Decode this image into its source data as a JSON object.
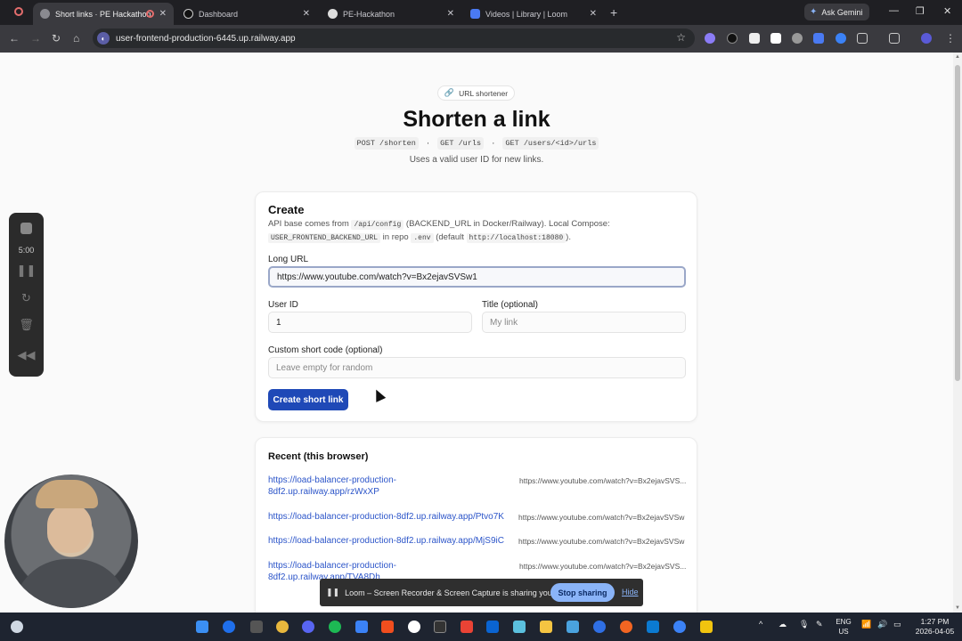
{
  "browser": {
    "tabs": [
      {
        "title": "Short links · PE Hackathon",
        "active": true
      },
      {
        "title": "Dashboard",
        "active": false
      },
      {
        "title": "PE-Hackathon",
        "active": false
      },
      {
        "title": "Videos | Library | Loom",
        "active": false
      }
    ],
    "gemini_label": "Ask Gemini",
    "address": "user-frontend-production-6445.up.railway.app"
  },
  "page": {
    "pill": "URL shortener",
    "title": "Shorten a link",
    "endpoints": [
      "POST /shorten",
      "GET /urls",
      "GET /users/<id>/urls"
    ],
    "endpoint_sep": "·",
    "subtitle": "Uses a valid user ID for new links.",
    "create": {
      "heading": "Create",
      "desc_1": "API base comes from",
      "desc_code_1": "/api/config",
      "desc_2": "(BACKEND_URL in Docker/Railway). Local Compose:",
      "desc_code_2": "USER_FRONTEND_BACKEND_URL",
      "desc_3": "in repo",
      "desc_code_3": ".env",
      "desc_4": "(default",
      "desc_code_4": "http://localhost:18080",
      "desc_5": ").",
      "long_url_label": "Long URL",
      "long_url_value": "https://www.youtube.com/watch?v=Bx2ejavSVSw1",
      "user_id_label": "User ID",
      "user_id_value": "1",
      "title_label": "Title (optional)",
      "title_placeholder": "My link",
      "code_label": "Custom short code (optional)",
      "code_placeholder": "Leave empty for random",
      "submit": "Create short link"
    },
    "recent": {
      "heading": "Recent (this browser)",
      "items": [
        {
          "short": "https://load-balancer-production-8df2.up.railway.app/rzWxXP",
          "original": "https://www.youtube.com/watch?v=Bx2ejavSVS..."
        },
        {
          "short": "https://load-balancer-production-8df2.up.railway.app/Ptvo7K",
          "original": "https://www.youtube.com/watch?v=Bx2ejavSVSw"
        },
        {
          "short": "https://load-balancer-production-8df2.up.railway.app/MjS9iC",
          "original": "https://www.youtube.com/watch?v=Bx2ejavSVSw"
        },
        {
          "short": "https://load-balancer-production-8df2.up.railway.app/TVA8Dh",
          "original": "https://www.youtube.com/watch?v=Bx2ejavSVS..."
        }
      ]
    }
  },
  "loom": {
    "timer": "5:00",
    "share_message": "Loom – Screen Recorder & Screen Capture is sharing your screen.",
    "stop_label": "Stop sharing",
    "hide_label": "Hide"
  },
  "taskbar": {
    "lang_1": "ENG",
    "lang_2": "US",
    "time": "1:27 PM",
    "date": "2026-04-05"
  }
}
